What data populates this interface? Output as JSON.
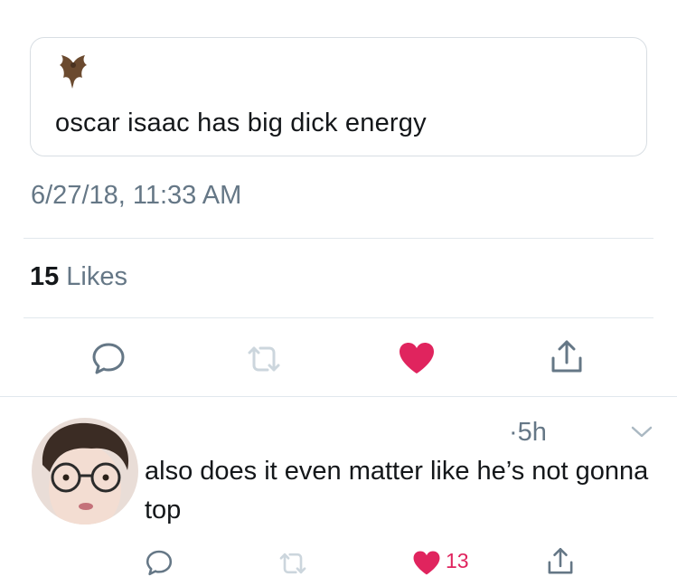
{
  "tweet": {
    "emoji_icon": "bat-emoji",
    "text": "oscar isaac has big dick energy",
    "timestamp": "6/27/18, 11:33 AM",
    "likes_count": "15",
    "likes_label": "Likes"
  },
  "reply": {
    "time": "·5h",
    "text": "also does it even matter like he’s not gonna top",
    "like_count": "13"
  },
  "colors": {
    "like_active": "#e0245e",
    "icon_gray": "#657786",
    "muted_icon": "#ccd6dd"
  }
}
